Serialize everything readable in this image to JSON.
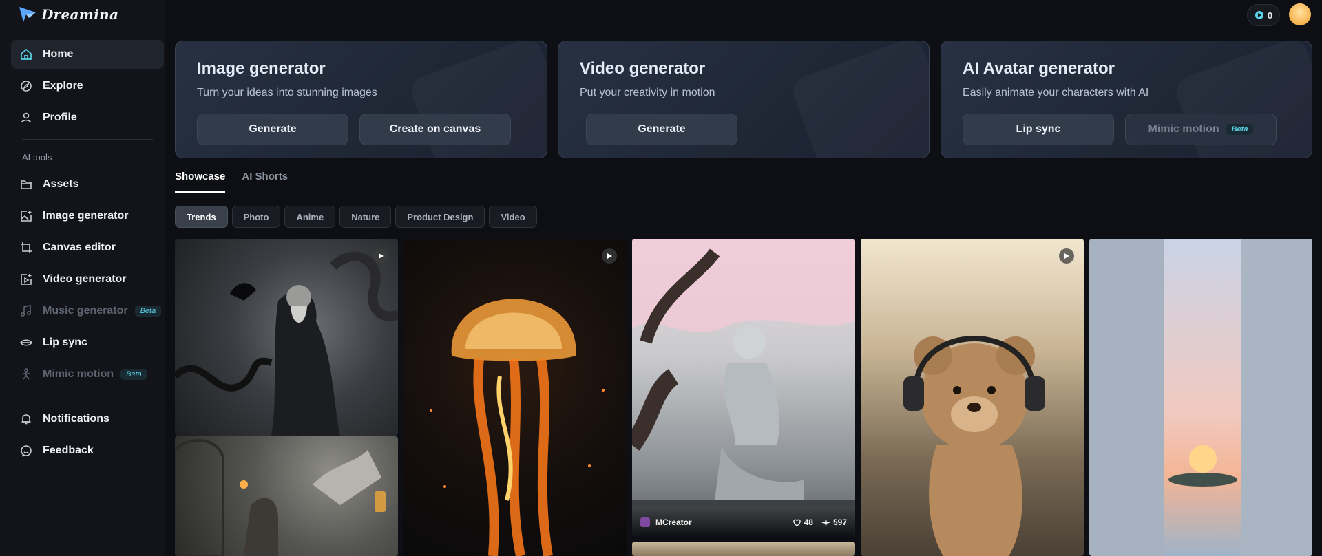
{
  "brand": {
    "name": "Dreamina"
  },
  "header": {
    "credits": "0"
  },
  "sidebar": {
    "main": [
      {
        "label": "Home",
        "icon": "home-icon",
        "active": true
      },
      {
        "label": "Explore",
        "icon": "compass-icon"
      },
      {
        "label": "Profile",
        "icon": "user-icon"
      }
    ],
    "tools_label": "AI tools",
    "tools": [
      {
        "label": "Assets",
        "icon": "folder-icon"
      },
      {
        "label": "Image generator",
        "icon": "image-plus-icon"
      },
      {
        "label": "Canvas editor",
        "icon": "crop-icon"
      },
      {
        "label": "Video generator",
        "icon": "video-plus-icon"
      },
      {
        "label": "Music generator",
        "icon": "music-icon",
        "disabled": true,
        "badge": "Beta"
      },
      {
        "label": "Lip sync",
        "icon": "lip-sync-icon"
      },
      {
        "label": "Mimic motion",
        "icon": "motion-icon",
        "disabled": true,
        "badge": "Beta"
      }
    ],
    "bottom": [
      {
        "label": "Notifications",
        "icon": "bell-icon"
      },
      {
        "label": "Feedback",
        "icon": "feedback-icon"
      }
    ]
  },
  "cards": [
    {
      "title": "Image generator",
      "subtitle": "Turn your ideas into stunning images",
      "buttons": [
        "Generate",
        "Create on canvas"
      ]
    },
    {
      "title": "Video generator",
      "subtitle": "Put your creativity in motion",
      "buttons": [
        "Generate"
      ]
    },
    {
      "title": "AI Avatar generator",
      "subtitle": "Easily animate your characters with AI",
      "buttons": [
        "Lip sync",
        "Mimic motion"
      ],
      "badge": "Beta"
    }
  ],
  "tabs": [
    "Showcase",
    "AI Shorts"
  ],
  "filters": [
    "Trends",
    "Photo",
    "Anime",
    "Nature",
    "Product Design",
    "Video"
  ],
  "gallery": {
    "featured": {
      "user": "MCreator",
      "likes": "48",
      "remixes": "597"
    }
  },
  "colors": {
    "background": "#0d0f14",
    "sidebar": "#12141a",
    "accent_beta": "#5ad2e6"
  }
}
